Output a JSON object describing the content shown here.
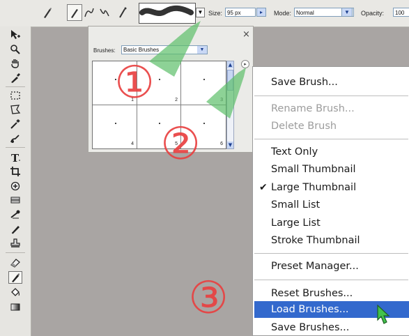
{
  "options_bar": {
    "size_label": "Size:",
    "size_value": "95 px",
    "mode_label": "Mode:",
    "mode_value": "Normal",
    "opacity_label": "Opacity:",
    "opacity_value": "100"
  },
  "brush_picker": {
    "brushes_label": "Brushes:",
    "brushes_value": "Basic Brushes",
    "close_glyph": "×",
    "cells": [
      "1",
      "2",
      "3",
      "4",
      "5",
      "6"
    ]
  },
  "menu": {
    "items": [
      {
        "label": "Save Brush...",
        "disabled": false
      },
      {
        "label": "Rename Brush...",
        "disabled": true
      },
      {
        "label": "Delete Brush",
        "disabled": true
      },
      {
        "label": "Text Only",
        "disabled": false
      },
      {
        "label": "Small Thumbnail",
        "disabled": false
      },
      {
        "label": "Large Thumbnail",
        "disabled": false,
        "checked": true
      },
      {
        "label": "Small List",
        "disabled": false
      },
      {
        "label": "Large List",
        "disabled": false
      },
      {
        "label": "Stroke Thumbnail",
        "disabled": false
      },
      {
        "label": "Preset Manager...",
        "disabled": false
      },
      {
        "label": "Reset Brushes...",
        "disabled": false
      },
      {
        "label": "Load Brushes...",
        "disabled": false,
        "highlighted": true
      },
      {
        "label": "Save Brushes...",
        "disabled": false
      }
    ],
    "check_glyph": "✔"
  },
  "annotations": {
    "step1": "①",
    "step2": "②",
    "step3": "③"
  },
  "colors": {
    "canvas": "#a9a5a3",
    "menu_highlight": "#3369cd",
    "annotation_red": "#e84040",
    "annotation_green": "#5cbf6a"
  }
}
